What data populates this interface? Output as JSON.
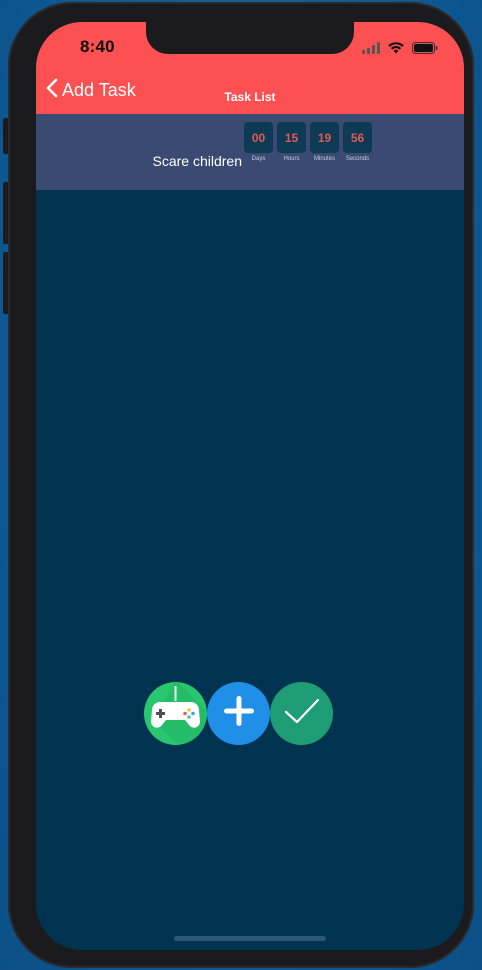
{
  "status_bar": {
    "time": "8:40",
    "icons": [
      "signal-icon",
      "wifi-icon",
      "battery-icon"
    ]
  },
  "nav": {
    "back_label": "Add Task",
    "back_icon": "chevron-left-icon",
    "title": "Task List"
  },
  "task": {
    "name": "Scare children",
    "countdown": [
      {
        "value": "00",
        "label": "Days"
      },
      {
        "value": "15",
        "label": "Hours"
      },
      {
        "value": "19",
        "label": "Minutes"
      },
      {
        "value": "56",
        "label": "Seconds"
      }
    ]
  },
  "actions": [
    {
      "icon": "game-controller-icon"
    },
    {
      "icon": "plus-icon"
    },
    {
      "icon": "checkmark-icon"
    }
  ],
  "colors": {
    "header": "#fd5052",
    "task_row": "#3a4a72",
    "background": "#003350",
    "countdown_digit": "#e25a56",
    "fab_game": "#28c76f",
    "fab_add": "#1f8fe8",
    "fab_done": "#1e9d74"
  }
}
